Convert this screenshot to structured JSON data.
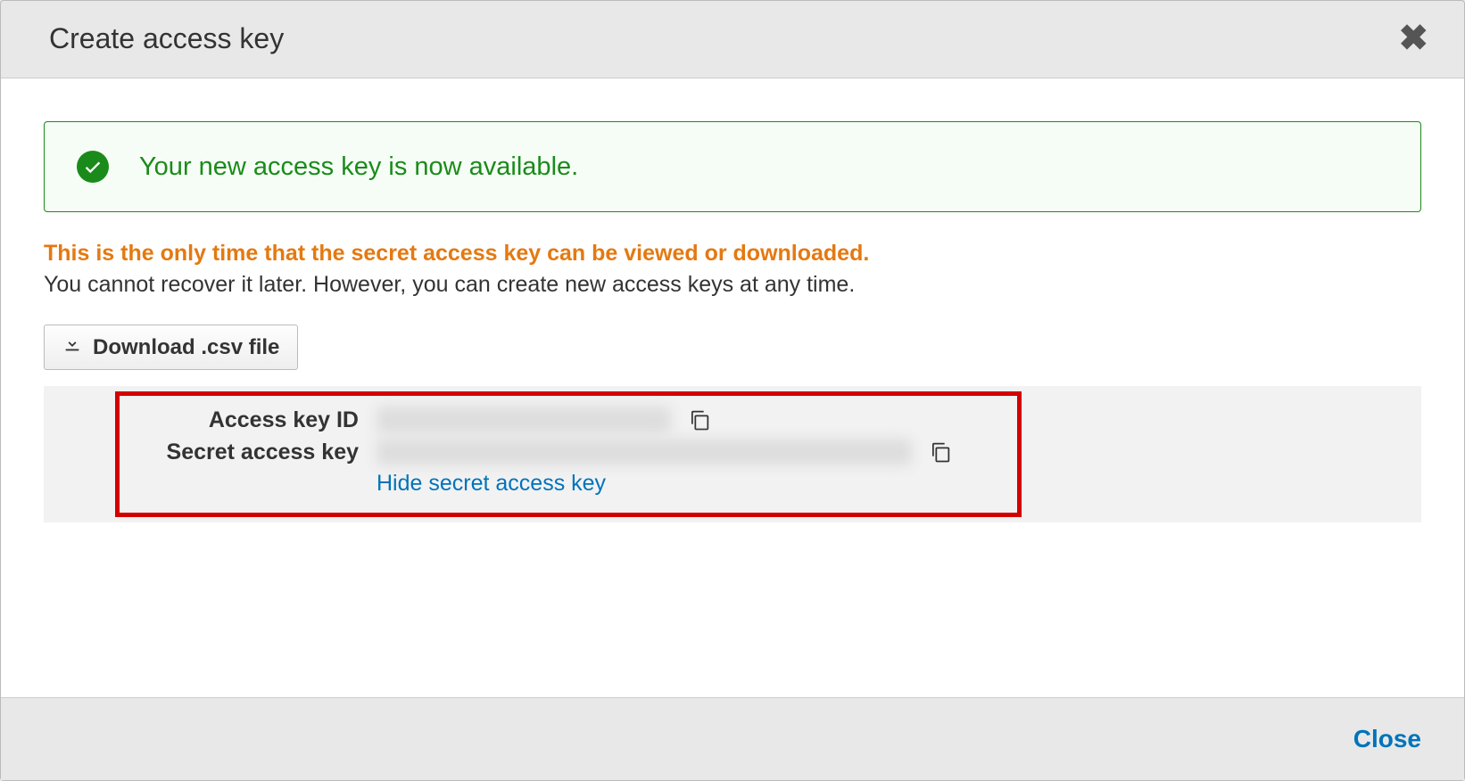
{
  "header": {
    "title": "Create access key"
  },
  "success": {
    "message": "Your new access key is now available."
  },
  "warning": {
    "bold_text": "This is the only time that the secret access key can be viewed or downloaded.",
    "info_text": "You cannot recover it later. However, you can create new access keys at any time."
  },
  "download_button": {
    "label": "Download .csv file"
  },
  "keys": {
    "access_key_id_label": "Access key ID",
    "secret_access_key_label": "Secret access key",
    "hide_link": "Hide secret access key"
  },
  "footer": {
    "close_label": "Close"
  }
}
